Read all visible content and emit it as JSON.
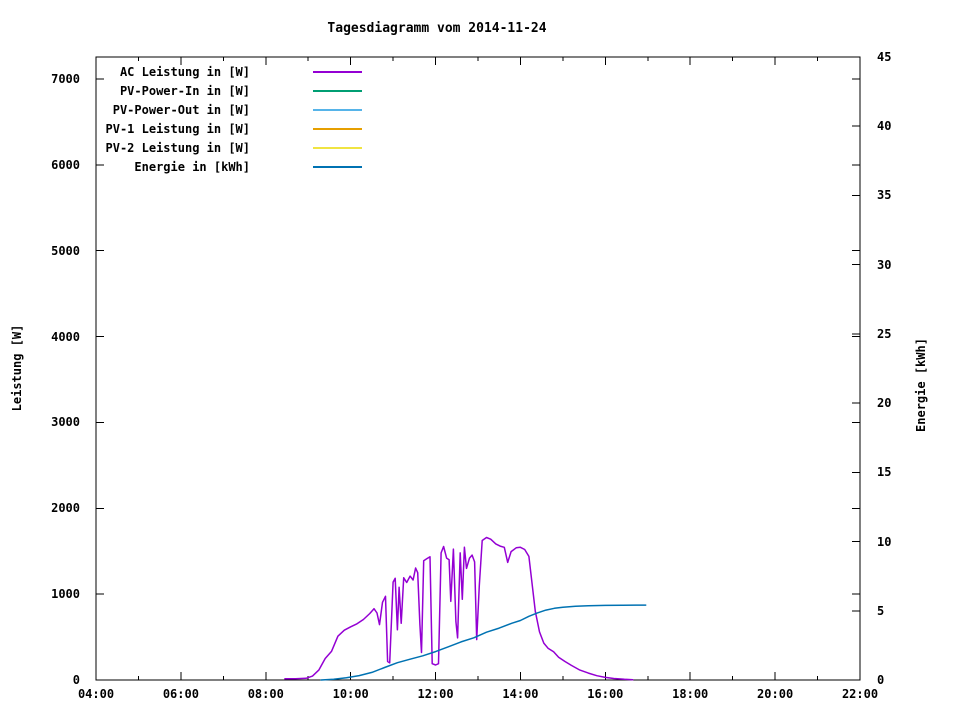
{
  "chart_data": {
    "type": "line",
    "title": "Tagesdiagramm vom 2014-11-24",
    "ylabel_left": "Leistung [W]",
    "ylabel_right": "Energie [kWh]",
    "x_axis": {
      "start_hour": 4,
      "end_hour": 22,
      "major_step_hours": 2,
      "minor_step_hours": 1,
      "tick_labels": [
        {
          "hour": 4,
          "label": "04:00"
        },
        {
          "hour": 6,
          "label": "06:00"
        },
        {
          "hour": 8,
          "label": "08:00"
        },
        {
          "hour": 10,
          "label": "10:00"
        },
        {
          "hour": 12,
          "label": "12:00"
        },
        {
          "hour": 14,
          "label": "14:00"
        },
        {
          "hour": 16,
          "label": "16:00"
        },
        {
          "hour": 18,
          "label": "18:00"
        },
        {
          "hour": 20,
          "label": "20:00"
        },
        {
          "hour": 22,
          "label": "22:00"
        }
      ]
    },
    "y_left": {
      "min": 0,
      "max": 7256,
      "unit": "W",
      "ticks": [
        {
          "value": 0,
          "label": "0"
        },
        {
          "value": 1000,
          "label": "1000"
        },
        {
          "value": 2000,
          "label": "2000"
        },
        {
          "value": 3000,
          "label": "3000"
        },
        {
          "value": 4000,
          "label": "4000"
        },
        {
          "value": 5000,
          "label": "5000"
        },
        {
          "value": 6000,
          "label": "6000"
        },
        {
          "value": 7000,
          "label": "7000"
        }
      ]
    },
    "y_right": {
      "min": 0,
      "max": 45,
      "unit": "kWh",
      "ticks": [
        {
          "value": 0,
          "label": "0"
        },
        {
          "value": 5,
          "label": "5"
        },
        {
          "value": 10,
          "label": "10"
        },
        {
          "value": 15,
          "label": "15"
        },
        {
          "value": 20,
          "label": "20"
        },
        {
          "value": 25,
          "label": "25"
        },
        {
          "value": 30,
          "label": "30"
        },
        {
          "value": 35,
          "label": "35"
        },
        {
          "value": 40,
          "label": "40"
        },
        {
          "value": 45,
          "label": "45"
        }
      ]
    },
    "legend_position": "top-left-inside",
    "grid": false,
    "series": [
      {
        "name": "AC Leistung in [W]",
        "axis": "left",
        "color": "#9400D3",
        "points": [
          [
            8.45,
            15
          ],
          [
            8.7,
            15
          ],
          [
            8.95,
            20
          ],
          [
            9.1,
            45
          ],
          [
            9.25,
            115
          ],
          [
            9.4,
            250
          ],
          [
            9.55,
            335
          ],
          [
            9.7,
            510
          ],
          [
            9.85,
            580
          ],
          [
            10.0,
            620
          ],
          [
            10.15,
            655
          ],
          [
            10.3,
            705
          ],
          [
            10.45,
            775
          ],
          [
            10.55,
            830
          ],
          [
            10.62,
            780
          ],
          [
            10.68,
            645
          ],
          [
            10.75,
            905
          ],
          [
            10.82,
            975
          ],
          [
            10.87,
            215
          ],
          [
            10.92,
            200
          ],
          [
            11.0,
            1140
          ],
          [
            11.05,
            1185
          ],
          [
            11.1,
            585
          ],
          [
            11.14,
            1080
          ],
          [
            11.19,
            660
          ],
          [
            11.25,
            1190
          ],
          [
            11.32,
            1135
          ],
          [
            11.4,
            1210
          ],
          [
            11.47,
            1165
          ],
          [
            11.53,
            1305
          ],
          [
            11.58,
            1250
          ],
          [
            11.63,
            645
          ],
          [
            11.67,
            320
          ],
          [
            11.72,
            1390
          ],
          [
            11.8,
            1415
          ],
          [
            11.87,
            1435
          ],
          [
            11.92,
            190
          ],
          [
            12.0,
            175
          ],
          [
            12.07,
            190
          ],
          [
            12.13,
            1480
          ],
          [
            12.19,
            1555
          ],
          [
            12.26,
            1420
          ],
          [
            12.32,
            1400
          ],
          [
            12.36,
            915
          ],
          [
            12.42,
            1525
          ],
          [
            12.48,
            680
          ],
          [
            12.52,
            490
          ],
          [
            12.58,
            1480
          ],
          [
            12.63,
            940
          ],
          [
            12.68,
            1545
          ],
          [
            12.73,
            1300
          ],
          [
            12.8,
            1420
          ],
          [
            12.86,
            1455
          ],
          [
            12.92,
            1375
          ],
          [
            12.97,
            470
          ],
          [
            13.03,
            1100
          ],
          [
            13.1,
            1625
          ],
          [
            13.2,
            1660
          ],
          [
            13.3,
            1640
          ],
          [
            13.42,
            1585
          ],
          [
            13.52,
            1560
          ],
          [
            13.62,
            1545
          ],
          [
            13.7,
            1370
          ],
          [
            13.78,
            1495
          ],
          [
            13.9,
            1540
          ],
          [
            14.0,
            1545
          ],
          [
            14.1,
            1520
          ],
          [
            14.2,
            1440
          ],
          [
            14.35,
            800
          ],
          [
            14.45,
            560
          ],
          [
            14.55,
            430
          ],
          [
            14.65,
            370
          ],
          [
            14.78,
            330
          ],
          [
            14.9,
            265
          ],
          [
            15.05,
            215
          ],
          [
            15.2,
            170
          ],
          [
            15.4,
            115
          ],
          [
            15.6,
            80
          ],
          [
            15.8,
            50
          ],
          [
            16.0,
            30
          ],
          [
            16.2,
            18
          ],
          [
            16.45,
            8
          ],
          [
            16.65,
            3
          ]
        ]
      },
      {
        "name": "PV-Power-In in [W]",
        "axis": "left",
        "color": "#009E73",
        "points": []
      },
      {
        "name": "PV-Power-Out in [W]",
        "axis": "left",
        "color": "#56B4E9",
        "points": []
      },
      {
        "name": "PV-1 Leistung in [W]",
        "axis": "left",
        "color": "#E69F00",
        "points": []
      },
      {
        "name": "PV-2 Leistung in [W]",
        "axis": "left",
        "color": "#F0E442",
        "points": []
      },
      {
        "name": "Energie in [kWh]",
        "axis": "right",
        "color": "#0072B2",
        "points": [
          [
            9.3,
            0.0
          ],
          [
            9.6,
            0.06
          ],
          [
            9.9,
            0.16
          ],
          [
            10.2,
            0.32
          ],
          [
            10.5,
            0.55
          ],
          [
            10.8,
            0.9
          ],
          [
            11.1,
            1.25
          ],
          [
            11.4,
            1.5
          ],
          [
            11.7,
            1.75
          ],
          [
            12.0,
            2.05
          ],
          [
            12.3,
            2.4
          ],
          [
            12.6,
            2.75
          ],
          [
            12.9,
            3.05
          ],
          [
            13.2,
            3.45
          ],
          [
            13.5,
            3.75
          ],
          [
            13.8,
            4.1
          ],
          [
            14.0,
            4.3
          ],
          [
            14.2,
            4.6
          ],
          [
            14.4,
            4.85
          ],
          [
            14.6,
            5.05
          ],
          [
            14.8,
            5.18
          ],
          [
            15.0,
            5.26
          ],
          [
            15.3,
            5.32
          ],
          [
            15.6,
            5.36
          ],
          [
            16.0,
            5.39
          ],
          [
            16.4,
            5.4
          ],
          [
            16.95,
            5.41
          ]
        ]
      }
    ]
  }
}
